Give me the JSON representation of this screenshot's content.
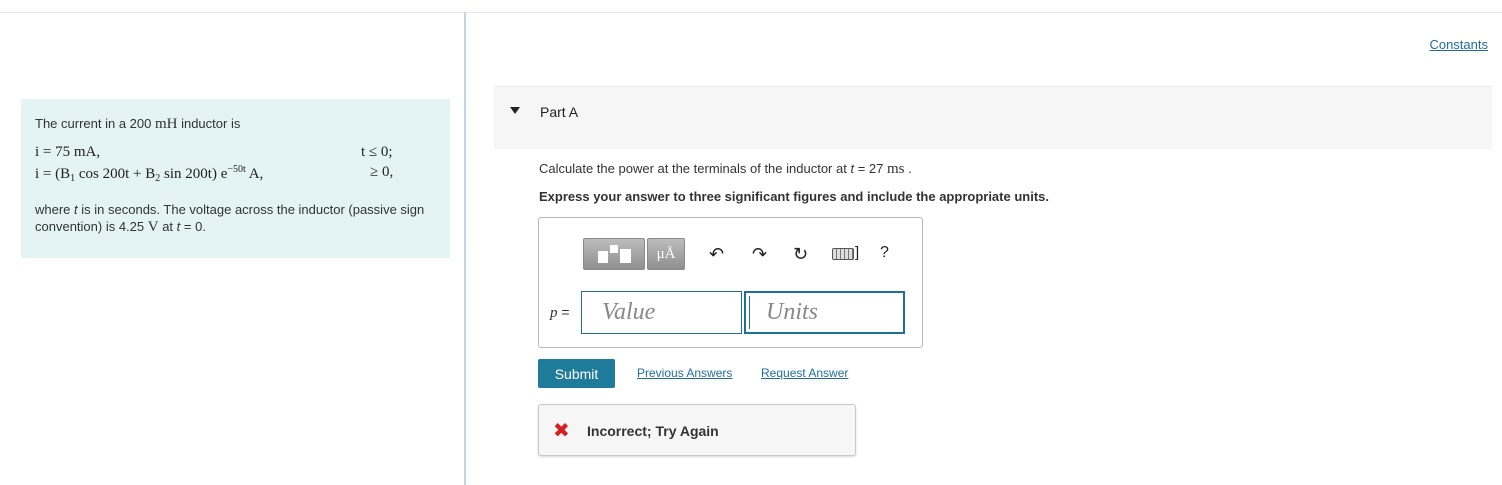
{
  "problem": {
    "intro_prefix": "The current in a 200 ",
    "intro_unit": "mH",
    "intro_suffix": " inductor is",
    "eq1": "i = 75 mA,",
    "eq1_condition": "t ≤ 0;",
    "eq2_prefix": "i = (B",
    "eq2_sub1": "1",
    "eq2_mid1": " cos 200t + B",
    "eq2_sub2": "2",
    "eq2_mid2": " sin 200t) e",
    "eq2_exp": "−50t",
    "eq2_suffix": " A,",
    "eq2_condition": "≥ 0,",
    "outro_1": "where ",
    "outro_t": "t",
    "outro_2": " is in seconds. The voltage across the inductor (passive sign convention) is 4.25 ",
    "outro_V": "V",
    "outro_3": " at ",
    "outro_t2": "t",
    "outro_4": " = 0."
  },
  "header": {
    "constants_link": "Constants"
  },
  "part": {
    "title": "Part A"
  },
  "question": {
    "text_prefix": "Calculate the power at the terminals of the inductor at ",
    "t_var": "t",
    "text_mid": " = 27  ",
    "unit": "ms",
    "text_suffix": " .",
    "instruction": "Express your answer to three significant figures and include the appropriate units."
  },
  "toolbar": {
    "units_button": "μÅ",
    "undo_icon": "↶",
    "redo_icon": "↷",
    "reset_icon": "↻",
    "bracket": "]",
    "help": "?"
  },
  "answer": {
    "var_name": "p",
    "var_equals": " =",
    "value_placeholder": "Value",
    "units_placeholder": "Units"
  },
  "actions": {
    "submit": "Submit",
    "previous_answers": "Previous Answers",
    "request_answer": "Request Answer"
  },
  "feedback": {
    "icon": "✖",
    "text": "Incorrect; Try Again"
  }
}
